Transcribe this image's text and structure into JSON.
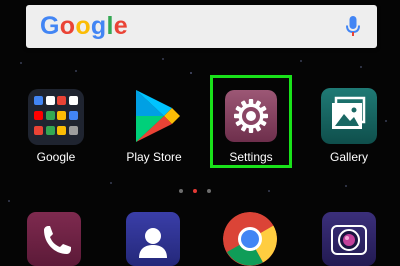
{
  "search_bar": {
    "logo_text": "Google",
    "logo_colors": [
      "#4285F4",
      "#EA4335",
      "#FBBC05",
      "#4285F4",
      "#34A853",
      "#EA4335"
    ],
    "mic_icon": "microphone-icon"
  },
  "apps": [
    {
      "label": "Google",
      "icon": "google-folder-icon"
    },
    {
      "label": "Play Store",
      "icon": "play-store-icon"
    },
    {
      "label": "Settings",
      "icon": "settings-gear-icon"
    },
    {
      "label": "Gallery",
      "icon": "gallery-icon"
    }
  ],
  "page_indicator": {
    "count": 3,
    "active_index": 1,
    "active_color": "#e53935"
  },
  "dock": [
    {
      "icon": "phone-icon"
    },
    {
      "icon": "contacts-icon"
    },
    {
      "icon": "chrome-icon"
    },
    {
      "icon": "camera-icon"
    }
  ],
  "highlight_color": "#19e21a"
}
